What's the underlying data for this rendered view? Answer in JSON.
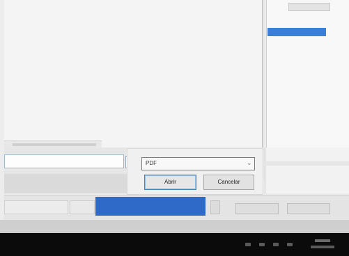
{
  "save_dialog": {
    "file_type": {
      "selected": "PDF"
    },
    "open_button": "Abrir",
    "cancel_button": "Cancelar"
  },
  "icons": {
    "dropdown": "chevron-down-icon"
  },
  "colors": {
    "selection": "#3a7fd8",
    "progress": "#2f6ac8",
    "default_button_border": "#3d86d6",
    "taskbar": "#0b0b0b"
  }
}
